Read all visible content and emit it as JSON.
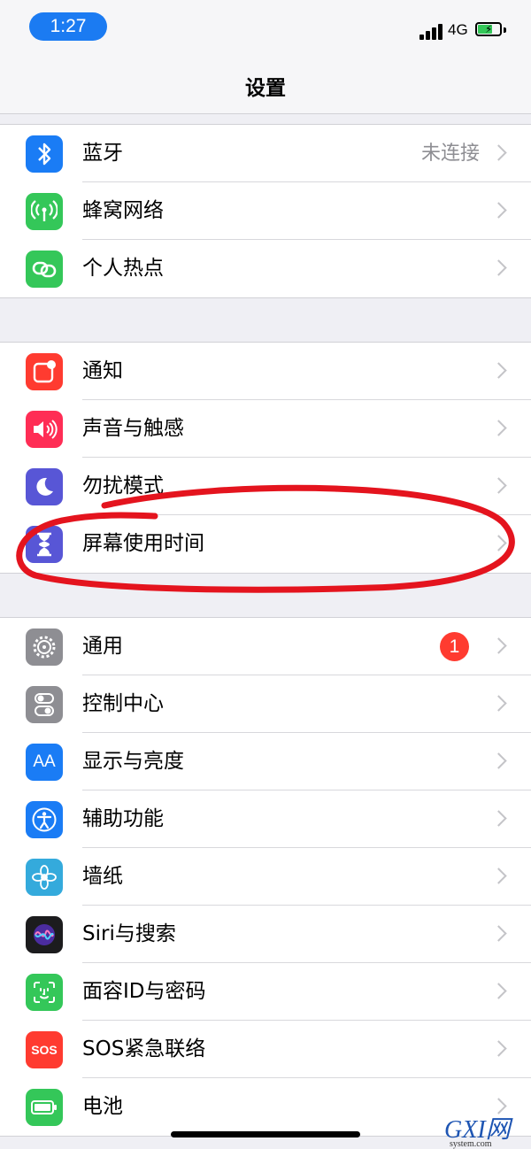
{
  "status": {
    "time": "1:27",
    "network": "4G"
  },
  "nav": {
    "title": "设置"
  },
  "groups": [
    {
      "rows": [
        {
          "label": "蓝牙",
          "value": "未连接",
          "icon": "bluetooth-icon",
          "color": "#1a7cf5"
        },
        {
          "label": "蜂窝网络",
          "icon": "cellular-antenna-icon",
          "color": "#34c759"
        },
        {
          "label": "个人热点",
          "icon": "hotspot-link-icon",
          "color": "#34c759"
        }
      ]
    },
    {
      "rows": [
        {
          "label": "通知",
          "icon": "notification-icon",
          "color": "#ff3b30"
        },
        {
          "label": "声音与触感",
          "icon": "speaker-icon",
          "color": "#ff2d55"
        },
        {
          "label": "勿扰模式",
          "icon": "moon-icon",
          "color": "#5856d6"
        },
        {
          "label": "屏幕使用时间",
          "icon": "hourglass-icon",
          "color": "#5856d6"
        }
      ]
    },
    {
      "rows": [
        {
          "label": "通用",
          "badge": "1",
          "icon": "gear-icon",
          "color": "#8e8e93"
        },
        {
          "label": "控制中心",
          "icon": "toggles-icon",
          "color": "#8e8e93"
        },
        {
          "label": "显示与亮度",
          "icon": "text-size-icon",
          "icon_text": "AA",
          "color": "#1a7cf5"
        },
        {
          "label": "辅助功能",
          "icon": "accessibility-icon",
          "color": "#1a7cf5"
        },
        {
          "label": "墙纸",
          "icon": "flower-icon",
          "color": "#34aadc"
        },
        {
          "label": "Siri与搜索",
          "icon": "siri-icon",
          "color": "#222"
        },
        {
          "label": "面容ID与密码",
          "icon": "face-id-icon",
          "color": "#34c759"
        },
        {
          "label": "SOS紧急联络",
          "icon": "sos-icon",
          "icon_text": "SOS",
          "color": "#ff3b30"
        },
        {
          "label": "电池",
          "icon": "battery-icon",
          "color": "#34c759"
        }
      ]
    }
  ],
  "watermark": {
    "brand": "GXI网",
    "domain": "system.com"
  }
}
